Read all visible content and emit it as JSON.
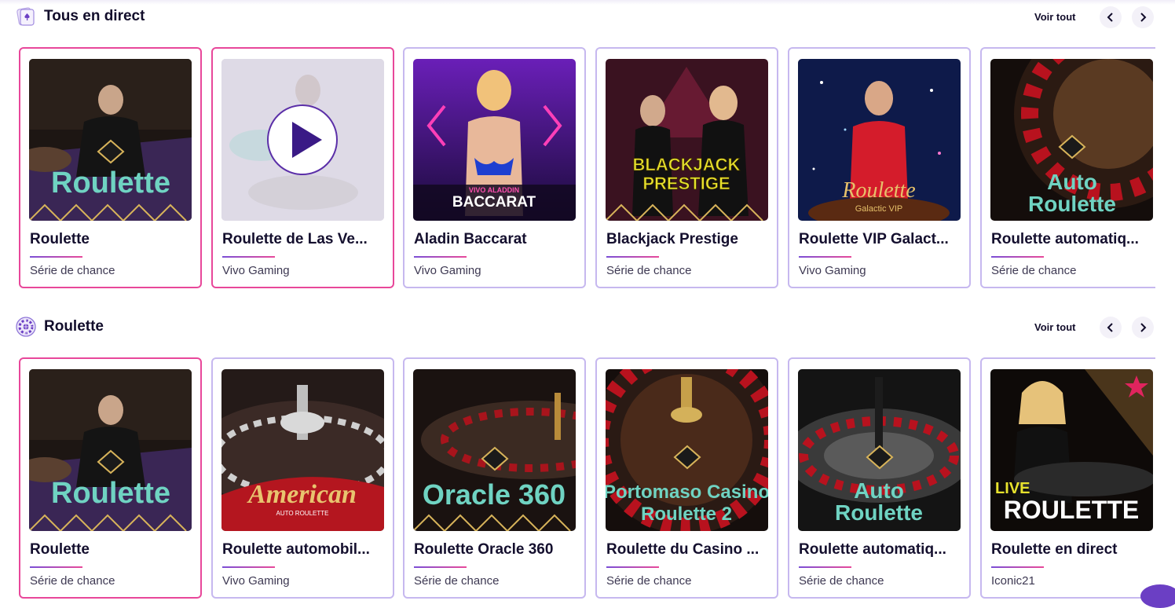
{
  "sections": [
    {
      "title": "Tous en direct",
      "see_all": "Voir tout",
      "icon": "cards-icon",
      "cards": [
        {
          "title": "Roulette",
          "provider": "Série de chance",
          "art": "Roulette",
          "highlight": true
        },
        {
          "title": "Roulette de Las Ve...",
          "provider": "Vivo Gaming",
          "art": "",
          "highlight": true,
          "playing": true
        },
        {
          "title": "Aladin Baccarat",
          "provider": "Vivo Gaming",
          "art": "BACCARAT",
          "art_top": "VIVO ALADDIN",
          "highlight": true
        },
        {
          "title": "Blackjack Prestige",
          "provider": "Série de chance",
          "art": "BLACKJACK",
          "art2": "PRESTIGE",
          "highlight": true
        },
        {
          "title": "Roulette VIP Galact...",
          "provider": "Vivo Gaming",
          "art": "Roulette",
          "art2": "Galactic VIP",
          "highlight": true
        },
        {
          "title": "Roulette automatiq...",
          "provider": "Série de chance",
          "art": "Auto",
          "art2": "Roulette",
          "highlight": true
        }
      ]
    },
    {
      "title": "Roulette",
      "see_all": "Voir tout",
      "icon": "roulette-wheel-icon",
      "cards": [
        {
          "title": "Roulette",
          "provider": "Série de chance",
          "art": "Roulette",
          "highlight": true
        },
        {
          "title": "Roulette automobil...",
          "provider": "Vivo Gaming",
          "art": "American",
          "art2": "AUTO ROULETTE",
          "highlight": true
        },
        {
          "title": "Roulette Oracle 360",
          "provider": "Série de chance",
          "art": "Oracle 360",
          "highlight": true
        },
        {
          "title": "Roulette du Casino ...",
          "provider": "Série de chance",
          "art": "Portomaso Casino",
          "art2": "Roulette 2",
          "highlight": true
        },
        {
          "title": "Roulette automatiq...",
          "provider": "Série de chance",
          "art": "Auto",
          "art2": "Roulette",
          "highlight": true
        },
        {
          "title": "Roulette en direct",
          "provider": "Iconic21",
          "art": "LIVE",
          "art2": "ROULETTE",
          "highlight": true
        }
      ]
    }
  ],
  "colors": {
    "accent": "#e8479a",
    "border": "#c6b8ef",
    "text": "#120d2b",
    "muted": "#3d3852",
    "teal": "#6fd3c2",
    "gold": "#d7b35a"
  }
}
